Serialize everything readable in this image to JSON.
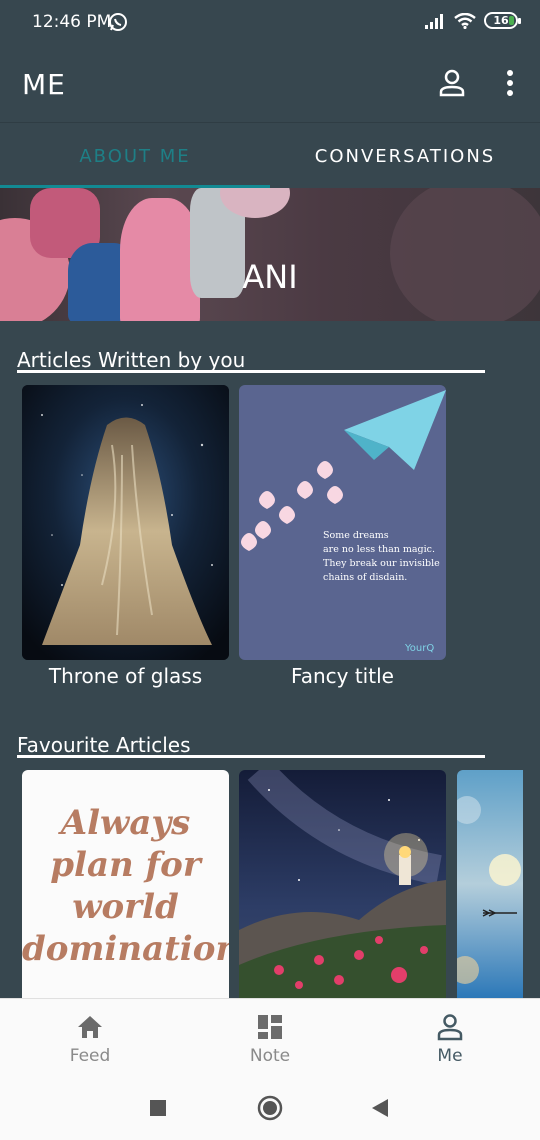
{
  "status_bar": {
    "time": "12:46 PM",
    "battery": "16",
    "icons": [
      "whatsapp-icon",
      "signal-icon",
      "wifi-icon",
      "battery-icon"
    ]
  },
  "app_bar": {
    "title": "ME",
    "icons": [
      "profile-icon",
      "more-vert-icon"
    ]
  },
  "tabs": [
    {
      "label": "ABOUT ME",
      "active": true
    },
    {
      "label": "CONVERSATIONS",
      "active": false
    }
  ],
  "profile": {
    "name": "ANI"
  },
  "articles_written": {
    "title": "Articles Written by you",
    "items": [
      {
        "caption": "Throne of glass"
      },
      {
        "caption": "Fancy title",
        "quote_lines": [
          "Some dreams",
          "are no less than magic.",
          "They break our invisible",
          "chains of disdain."
        ],
        "watermark": "YourQ"
      }
    ]
  },
  "favourite_articles": {
    "title": "Favourite Articles",
    "items": [
      {
        "image_text": [
          "Always",
          "plan for",
          "world",
          "domination"
        ]
      },
      {},
      {}
    ]
  },
  "bottom_nav": [
    {
      "label": "Feed",
      "icon": "home-icon",
      "active": false
    },
    {
      "label": "Note",
      "icon": "dashboard-icon",
      "active": false
    },
    {
      "label": "Me",
      "icon": "person-icon",
      "active": true
    }
  ],
  "system_nav": [
    "recents-icon",
    "home-circle-icon",
    "back-icon"
  ],
  "colors": {
    "background": "#37474f",
    "accent": "#128a93",
    "nav_background": "#fafafa"
  }
}
